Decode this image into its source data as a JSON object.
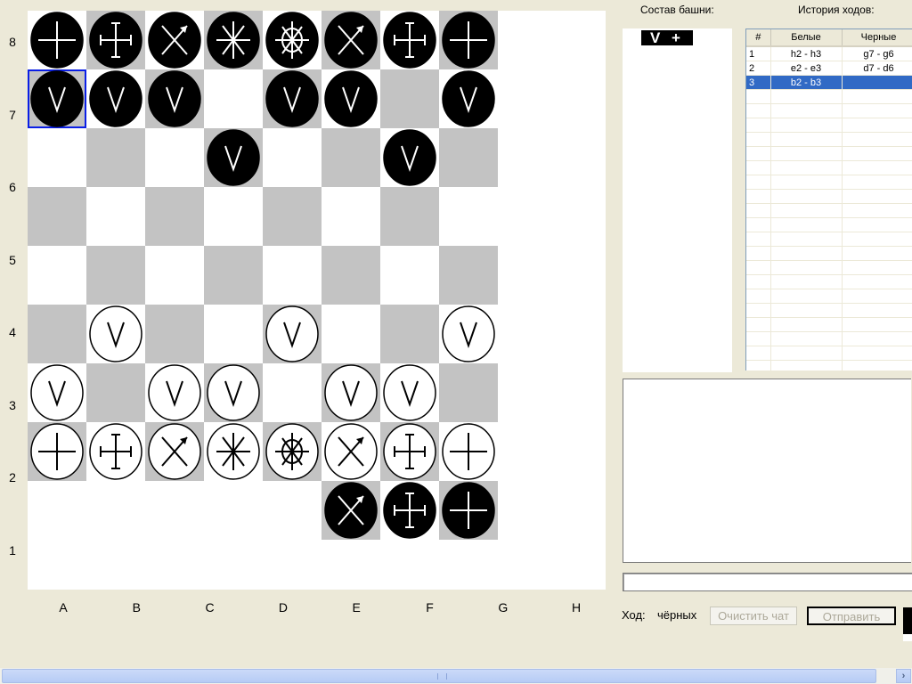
{
  "board": {
    "row_labels": [
      "8",
      "7",
      "6",
      "5",
      "4",
      "3",
      "2",
      "1"
    ],
    "col_labels": [
      "A",
      "B",
      "C",
      "D",
      "E",
      "F",
      "G",
      "H"
    ],
    "light_color": "#ffffff",
    "dark_color": "#c3c3c3",
    "selection_color": "#0a1ee6",
    "selected": {
      "row": 1,
      "col": 0
    },
    "rows": [
      [
        "b:plus",
        "b:barcross",
        "b:xarrow",
        "b:star",
        "b:wheel",
        "b:xarrow",
        "b:barcross",
        "b:plus"
      ],
      [
        "b:v",
        "b:v",
        "b:v",
        "",
        "b:v",
        "b:v",
        "",
        "b:v"
      ],
      [
        "",
        "",
        "",
        "b:v",
        "",
        "",
        "b:v",
        ""
      ],
      [
        "",
        "",
        "",
        "",
        "",
        "",
        "",
        ""
      ],
      [
        "",
        "",
        "",
        "",
        "",
        "",
        "",
        ""
      ],
      [
        "",
        "w:v",
        "",
        "",
        "w:v",
        "",
        "",
        "w:v"
      ],
      [
        "w:v",
        "",
        "w:v",
        "w:v",
        "",
        "w:v",
        "w:v",
        ""
      ],
      [
        "w:plus",
        "w:barcross",
        "w:xarrow",
        "w:star",
        "w:wheel",
        "w:xarrow",
        "w:barcross",
        "w:plus"
      ]
    ],
    "extra_row": [
      null,
      null,
      null,
      null,
      null,
      "b:xarrow",
      "b:barcross",
      "b:plus"
    ]
  },
  "tower": {
    "title": "Состав башни:",
    "tag": "V +"
  },
  "history": {
    "title": "История ходов:",
    "columns": [
      "#",
      "Белые",
      "Черные"
    ],
    "rows": [
      {
        "n": "1",
        "white": "h2 - h3",
        "black": "g7 - g6"
      },
      {
        "n": "2",
        "white": "e2 - e3",
        "black": "d7 - d6"
      },
      {
        "n": "3",
        "white": "b2 - b3",
        "black": ""
      }
    ],
    "selected_row": 2,
    "selection_color": "#316ac5"
  },
  "chat": {
    "log": "",
    "input_value": ""
  },
  "status": {
    "turn_label": "Ход:",
    "turn_value": "чёрных"
  },
  "buttons": {
    "clear_chat": "Очистить чат",
    "send": "Отправить"
  },
  "scrollbar": {
    "right_arrow": "›"
  }
}
